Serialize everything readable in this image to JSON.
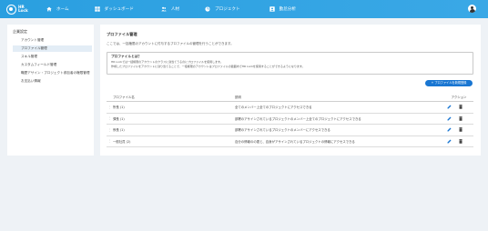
{
  "app": {
    "logo_line1": "HR",
    "logo_line2": "Lock"
  },
  "nav": {
    "items": [
      {
        "label": "ホーム",
        "icon": "home-icon"
      },
      {
        "label": "ダッシュボード",
        "icon": "dashboard-icon"
      },
      {
        "label": "人材",
        "icon": "people-icon"
      },
      {
        "label": "プロジェクト",
        "icon": "project-icon"
      },
      {
        "label": "勤怠分析",
        "icon": "analysis-icon"
      }
    ]
  },
  "sidebar": {
    "title": "企業設定",
    "items": [
      {
        "label": "アカウント管理",
        "active": false
      },
      {
        "label": "プロファイル管理",
        "active": true
      },
      {
        "label": "スキル管理",
        "active": false
      },
      {
        "label": "カスタムフィールド管理",
        "active": false
      },
      {
        "label": "職歴アサイン・プロジェクト参加者の権限管理",
        "active": false
      },
      {
        "label": "お支払い情報",
        "active": false
      }
    ]
  },
  "main": {
    "title": "プロファイル管理",
    "subtitle": "ここでは、一括権限のアカウントに付与するプロファイルの管理を行うことができます。",
    "info": {
      "heading": "プロファイルとは？",
      "line1": "HR Lockでは一括権限のアカウントのクラスに割当てうるのにプロファイルを使用します。",
      "line2": "作成したプロファイルをアカウントに割り当てることで、一括権限のアカウントはプロファイルの範囲内でHR Lockを使用することができるようになります。"
    },
    "add_button": "+ プロファイルを新規登録",
    "table": {
      "headers": {
        "name": "プロファイル名",
        "desc": "説明",
        "actions": "アクション"
      },
      "rows": [
        {
          "name": "所長 (1)",
          "desc": "全てのメンバー上全てのプロジェクトにアクセスできる"
        },
        {
          "name": "課長 (1)",
          "desc": "部署のアサインされているプロジェクトのメンバー上全てのプロジェクトにアクセスできる"
        },
        {
          "name": "係長 (1)",
          "desc": "部署のアサインされているプロジェクトのメンバーにアクセスできる"
        },
        {
          "name": "一般社員 (2)",
          "desc": "自分の情報のの更と、自身がアサインされているプロジェクトの情報にアクセスできる"
        }
      ]
    }
  },
  "colors": {
    "topbar": "#2a9fe0",
    "accent": "#1976d2",
    "active_bg": "#e3edf6"
  }
}
